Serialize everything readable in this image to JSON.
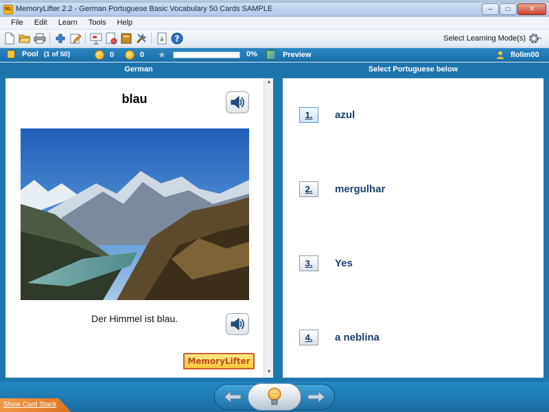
{
  "window": {
    "app_icon_text": "ML",
    "title": "MemoryLifter 2.2 - German Portuguese Basic Vocabulary 50 Cards SAMPLE",
    "minimize": "–",
    "maximize": "□",
    "close": "✕"
  },
  "menu": [
    "File",
    "Edit",
    "Learn",
    "Tools",
    "Help"
  ],
  "toolbar": {
    "icons": [
      "new-icon",
      "open-icon",
      "print-icon",
      "add-card-icon",
      "edit-icon",
      "slideshow-icon",
      "print-cards-icon",
      "book-icon",
      "tools-icon",
      "character-map-icon",
      "help-icon"
    ],
    "select_mode_label": "Select Learning Mode(s)"
  },
  "status": {
    "pool_label": "Pool",
    "pool_count": "(1 of 50)",
    "happy_count": "0",
    "sad_count": "0",
    "progress_percent": 0,
    "progress_label": "0%",
    "preview_label": "Preview",
    "user_name": "flolim00"
  },
  "columns": {
    "left_header": "German",
    "right_header": "Select Portuguese below"
  },
  "question": {
    "word": "blau",
    "sentence": "Der Himmel ist blau.",
    "logo_text": "MemoryLifter"
  },
  "answers": [
    {
      "number": "1.",
      "text": "azul"
    },
    {
      "number": "2.",
      "text": "mergulhar"
    },
    {
      "number": "3.",
      "text": "Yes"
    },
    {
      "number": "4.",
      "text": "a neblina"
    }
  ],
  "footer": {
    "show_card_stack": "Show Card Stack"
  },
  "colors": {
    "accent_blue": "#1e76ae",
    "answer_text": "#1c3f6e",
    "progress_fill": "#8fd18f"
  }
}
